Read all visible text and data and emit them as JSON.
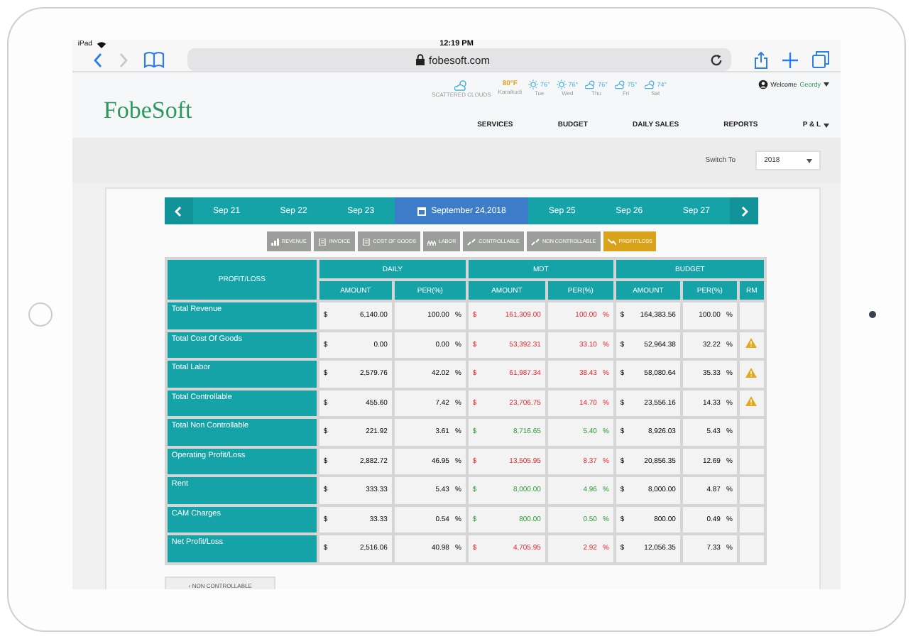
{
  "status_bar": {
    "device": "iPad",
    "time": "12:19 PM"
  },
  "browser": {
    "url": "fobesoft.com"
  },
  "header": {
    "logo": "FobeSoft",
    "current_weather": {
      "condition": "SCATTERED CLOUDS",
      "temperature": "80°F",
      "city": "Karaikudi"
    },
    "forecast": [
      {
        "kind": "sun",
        "temperature": "76°",
        "day": "Tue"
      },
      {
        "kind": "sun",
        "temperature": "76°",
        "day": "Wed"
      },
      {
        "kind": "cloud",
        "temperature": "76°",
        "day": "Thu"
      },
      {
        "kind": "cloud",
        "temperature": "75°",
        "day": "Fri"
      },
      {
        "kind": "cloud",
        "temperature": "74°",
        "day": "Sat"
      }
    ],
    "greeting": "Welcome",
    "user": "Geordy",
    "nav": [
      {
        "label": "SERVICES",
        "dropdown": false
      },
      {
        "label": "BUDGET",
        "dropdown": false
      },
      {
        "label": "DAILY SALES",
        "dropdown": false
      },
      {
        "label": "REPORTS",
        "dropdown": false
      },
      {
        "label": "P & L",
        "dropdown": true
      }
    ]
  },
  "switch": {
    "label": "Switch To",
    "value": "2018"
  },
  "dates": [
    {
      "label": "Sep 21",
      "selected": false
    },
    {
      "label": "Sep 22",
      "selected": false
    },
    {
      "label": "Sep 23",
      "selected": false
    },
    {
      "label": "September 24,2018",
      "selected": true
    },
    {
      "label": "Sep 25",
      "selected": false
    },
    {
      "label": "Sep 26",
      "selected": false
    },
    {
      "label": "Sep 27",
      "selected": false
    }
  ],
  "filters": [
    {
      "label": "REVENUE",
      "kind": "chart",
      "selected": false
    },
    {
      "label": "INVOICE",
      "kind": "doc",
      "selected": false
    },
    {
      "label": "COST OF GOODS",
      "kind": "doc",
      "selected": false
    },
    {
      "label": "LABOR",
      "kind": "people",
      "selected": false
    },
    {
      "label": "CONTROLLABLE",
      "kind": "link",
      "selected": false
    },
    {
      "label": "NON CONTROLLABLE",
      "kind": "link",
      "selected": false
    },
    {
      "label": "PROFIT/LOSS",
      "kind": "trend",
      "selected": true
    }
  ],
  "table": {
    "title": "PROFIT/LOSS",
    "groups": [
      {
        "label": "DAILY",
        "columns": [
          "AMOUNT",
          "PER(%)"
        ]
      },
      {
        "label": "MDT",
        "columns": [
          "AMOUNT",
          "PER(%)"
        ]
      },
      {
        "label": "BUDGET",
        "columns": [
          "AMOUNT",
          "PER(%)",
          "RM"
        ]
      }
    ],
    "rows": [
      {
        "label": "Total Revenue",
        "warning": false,
        "mdt_favorable": false,
        "cells": [
          {
            "kind": "amount",
            "symbol": "$",
            "value": "6,140.00"
          },
          {
            "kind": "percent",
            "value": "100.00",
            "symbol": "%"
          },
          {
            "kind": "amount",
            "symbol": "$",
            "value": "161,309.00",
            "mdt": true
          },
          {
            "kind": "percent",
            "value": "100.00",
            "symbol": "%",
            "mdt": true
          },
          {
            "kind": "amount",
            "symbol": "$",
            "value": "164,383.56"
          },
          {
            "kind": "percent",
            "value": "100.00",
            "symbol": "%"
          }
        ]
      },
      {
        "label": "Total Cost Of Goods",
        "warning": true,
        "mdt_favorable": false,
        "cells": [
          {
            "kind": "amount",
            "symbol": "$",
            "value": "0.00"
          },
          {
            "kind": "percent",
            "value": "0.00",
            "symbol": "%"
          },
          {
            "kind": "amount",
            "symbol": "$",
            "value": "53,392.31",
            "mdt": true
          },
          {
            "kind": "percent",
            "value": "33.10",
            "symbol": "%",
            "mdt": true
          },
          {
            "kind": "amount",
            "symbol": "$",
            "value": "52,964.38"
          },
          {
            "kind": "percent",
            "value": "32.22",
            "symbol": "%"
          }
        ]
      },
      {
        "label": "Total Labor",
        "warning": true,
        "mdt_favorable": false,
        "cells": [
          {
            "kind": "amount",
            "symbol": "$",
            "value": "2,579.76"
          },
          {
            "kind": "percent",
            "value": "42.02",
            "symbol": "%"
          },
          {
            "kind": "amount",
            "symbol": "$",
            "value": "61,987.34",
            "mdt": true
          },
          {
            "kind": "percent",
            "value": "38.43",
            "symbol": "%",
            "mdt": true
          },
          {
            "kind": "amount",
            "symbol": "$",
            "value": "58,080.64"
          },
          {
            "kind": "percent",
            "value": "35.33",
            "symbol": "%"
          }
        ]
      },
      {
        "label": "Total Controllable",
        "warning": true,
        "mdt_favorable": false,
        "cells": [
          {
            "kind": "amount",
            "symbol": "$",
            "value": "455.60"
          },
          {
            "kind": "percent",
            "value": "7.42",
            "symbol": "%"
          },
          {
            "kind": "amount",
            "symbol": "$",
            "value": "23,706.75",
            "mdt": true
          },
          {
            "kind": "percent",
            "value": "14.70",
            "symbol": "%",
            "mdt": true
          },
          {
            "kind": "amount",
            "symbol": "$",
            "value": "23,556.16"
          },
          {
            "kind": "percent",
            "value": "14.33",
            "symbol": "%"
          }
        ]
      },
      {
        "label": "Total Non Controllable",
        "warning": false,
        "mdt_favorable": true,
        "cells": [
          {
            "kind": "amount",
            "symbol": "$",
            "value": "221.92"
          },
          {
            "kind": "percent",
            "value": "3.61",
            "symbol": "%"
          },
          {
            "kind": "amount",
            "symbol": "$",
            "value": "8,716.65",
            "mdt": true
          },
          {
            "kind": "percent",
            "value": "5.40",
            "symbol": "%",
            "mdt": true
          },
          {
            "kind": "amount",
            "symbol": "$",
            "value": "8,926.03"
          },
          {
            "kind": "percent",
            "value": "5.43",
            "symbol": "%"
          }
        ]
      },
      {
        "label": "Operating Profit/Loss",
        "warning": false,
        "mdt_favorable": false,
        "cells": [
          {
            "kind": "amount",
            "symbol": "$",
            "value": "2,882.72"
          },
          {
            "kind": "percent",
            "value": "46.95",
            "symbol": "%"
          },
          {
            "kind": "amount",
            "symbol": "$",
            "value": "13,505.95",
            "mdt": true
          },
          {
            "kind": "percent",
            "value": "8.37",
            "symbol": "%",
            "mdt": true
          },
          {
            "kind": "amount",
            "symbol": "$",
            "value": "20,856.35"
          },
          {
            "kind": "percent",
            "value": "12.69",
            "symbol": "%"
          }
        ]
      },
      {
        "label": "Rent",
        "warning": false,
        "mdt_favorable": true,
        "cells": [
          {
            "kind": "amount",
            "symbol": "$",
            "value": "333.33"
          },
          {
            "kind": "percent",
            "value": "5.43",
            "symbol": "%"
          },
          {
            "kind": "amount",
            "symbol": "$",
            "value": "8,000.00",
            "mdt": true
          },
          {
            "kind": "percent",
            "value": "4.96",
            "symbol": "%",
            "mdt": true
          },
          {
            "kind": "amount",
            "symbol": "$",
            "value": "8,000.00"
          },
          {
            "kind": "percent",
            "value": "4.87",
            "symbol": "%"
          }
        ]
      },
      {
        "label": "CAM Charges",
        "warning": false,
        "mdt_favorable": true,
        "cells": [
          {
            "kind": "amount",
            "symbol": "$",
            "value": "33.33"
          },
          {
            "kind": "percent",
            "value": "0.54",
            "symbol": "%"
          },
          {
            "kind": "amount",
            "symbol": "$",
            "value": "800.00",
            "mdt": true
          },
          {
            "kind": "percent",
            "value": "0.50",
            "symbol": "%",
            "mdt": true
          },
          {
            "kind": "amount",
            "symbol": "$",
            "value": "800.00"
          },
          {
            "kind": "percent",
            "value": "0.49",
            "symbol": "%"
          }
        ]
      },
      {
        "label": "Net Profit/Loss",
        "warning": false,
        "mdt_favorable": false,
        "cells": [
          {
            "kind": "amount",
            "symbol": "$",
            "value": "2,516.06"
          },
          {
            "kind": "percent",
            "value": "40.98",
            "symbol": "%"
          },
          {
            "kind": "amount",
            "symbol": "$",
            "value": "4,705.95",
            "mdt": true
          },
          {
            "kind": "percent",
            "value": "2.92",
            "symbol": "%",
            "mdt": true
          },
          {
            "kind": "amount",
            "symbol": "$",
            "value": "12,056.35"
          },
          {
            "kind": "percent",
            "value": "7.33",
            "symbol": "%"
          }
        ]
      }
    ]
  },
  "back_button": "‹ NON CONTROLLABLE"
}
